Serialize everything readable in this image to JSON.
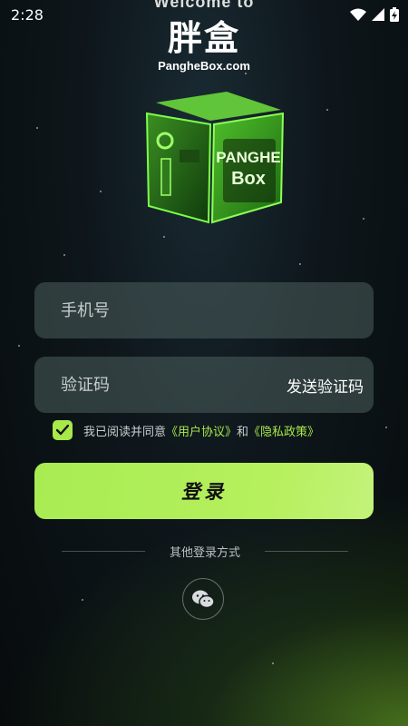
{
  "status_bar": {
    "time": "2:28",
    "icons": [
      "wifi-icon",
      "signal-icon",
      "battery-charging-icon"
    ]
  },
  "brand": {
    "top_text": "Welcome to",
    "logo_text": "胖盒",
    "url": "PangheBox.com",
    "cube_label_line1": "PANGHE",
    "cube_label_line2": "Box"
  },
  "form": {
    "phone_placeholder": "手机号",
    "code_placeholder": "验证码",
    "send_code_label": "发送验证码",
    "agreement_prefix": "我已阅读并同意",
    "user_agreement_link": "《用户协议》",
    "agreement_and": "和",
    "privacy_link": "《隐私政策》",
    "agreement_checked": true,
    "login_label": "登录"
  },
  "other_login": {
    "label": "其他登录方式",
    "methods": [
      "wechat-icon"
    ]
  },
  "colors": {
    "accent": "#a7e84a",
    "field_bg": "#4c5e5c",
    "text_muted": "#c7cdcd"
  }
}
